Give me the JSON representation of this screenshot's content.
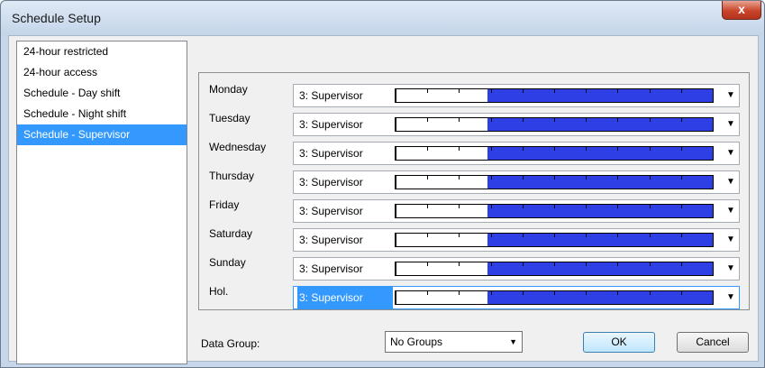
{
  "window": {
    "title": "Schedule Setup",
    "close_glyph": "x"
  },
  "toolbar": {
    "add_icon": "+",
    "remove_icon": "−"
  },
  "schedules": [
    {
      "label": "24-hour restricted",
      "selected": false
    },
    {
      "label": "24-hour access",
      "selected": false
    },
    {
      "label": "Schedule - Day shift",
      "selected": false
    },
    {
      "label": "Schedule - Night shift",
      "selected": false
    },
    {
      "label": "Schedule - Supervisor",
      "selected": true
    }
  ],
  "days": [
    {
      "day": "Monday",
      "level": "3: Supervisor",
      "active_from_fraction": 0.29
    },
    {
      "day": "Tuesday",
      "level": "3: Supervisor",
      "active_from_fraction": 0.29
    },
    {
      "day": "Wednesday",
      "level": "3: Supervisor",
      "active_from_fraction": 0.29
    },
    {
      "day": "Thursday",
      "level": "3: Supervisor",
      "active_from_fraction": 0.29
    },
    {
      "day": "Friday",
      "level": "3: Supervisor",
      "active_from_fraction": 0.29
    },
    {
      "day": "Saturday",
      "level": "3: Supervisor",
      "active_from_fraction": 0.29
    },
    {
      "day": "Sunday",
      "level": "3: Supervisor",
      "active_from_fraction": 0.29
    },
    {
      "day": "Hol.",
      "level": "3: Supervisor",
      "active_from_fraction": 0.29,
      "highlight": true
    }
  ],
  "dropdown_arrow": "▼",
  "data_group": {
    "label": "Data Group:",
    "value": "No Groups",
    "caret": "▼"
  },
  "buttons": {
    "ok": "OK",
    "cancel": "Cancel"
  },
  "colors": {
    "schedule_fill": "#2f3fe6",
    "selection": "#3399ff"
  }
}
